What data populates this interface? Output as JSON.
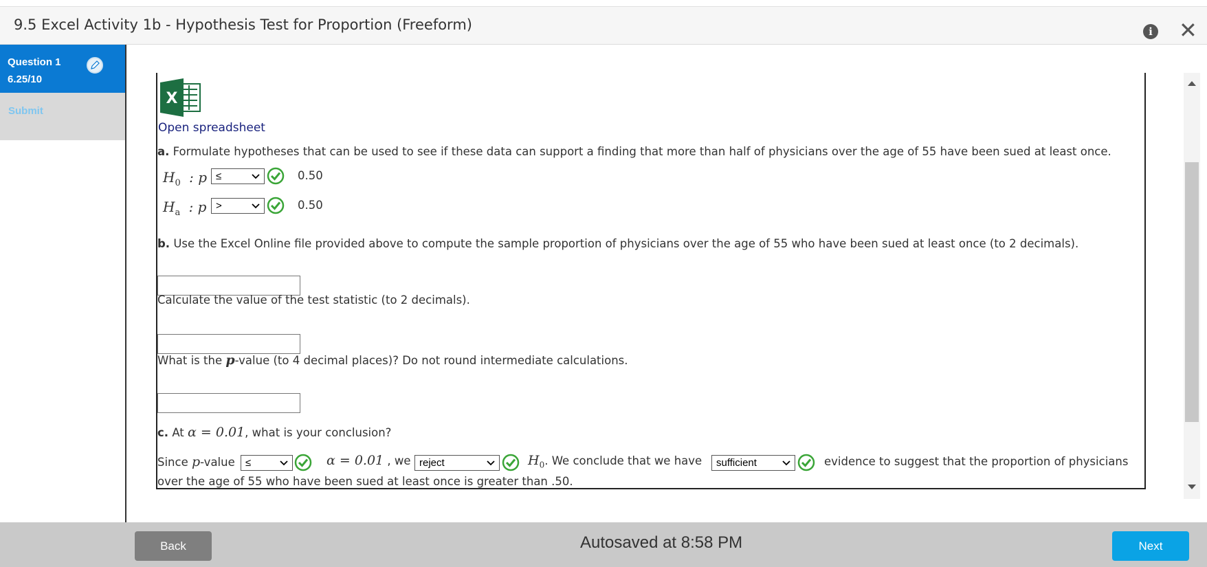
{
  "window": {
    "title": "9.5 Excel Activity 1b - Hypothesis Test for Proportion (Freeform)"
  },
  "sidebar": {
    "question_label": "Question 1",
    "question_score": "6.25/10",
    "submit_label": "Submit"
  },
  "content": {
    "open_spreadsheet": "Open spreadsheet",
    "part_a": {
      "letter": "a.",
      "text": "Formulate hypotheses that can be used to see if these data can support a finding that more than half of physicians over the age of 55 have been sued at least once.",
      "h0_symbol": "H",
      "h0_sub": "0",
      "ha_symbol": "H",
      "ha_sub": "a",
      "colon_p": ": p",
      "h0_operator": "≤",
      "h0_value": "0.50",
      "ha_operator": ">",
      "ha_value": "0.50"
    },
    "part_b": {
      "letter": "b.",
      "text": "Use the Excel Online file provided above to compute the sample proportion of physicians over the age of 55 who have been sued at least once (to 2 decimals).",
      "sample_prop_value": "",
      "test_stat_text": "Calculate the value of the test statistic (to 2 decimals).",
      "test_stat_value": "",
      "pvalue_pre": "What is the ",
      "pvalue_var": "p",
      "pvalue_post": "-value (to 4 decimal places)? Do not round intermediate calculations.",
      "pvalue_value": ""
    },
    "part_c": {
      "letter": "c.",
      "at": "At",
      "alpha_expr": "α = 0.01",
      "question": ", what is your conclusion?",
      "since": "Since",
      "p_var": "p",
      "value_word": "-value",
      "pvalue_operator": "≤",
      "alpha_expr2": "α = 0.01",
      "we": ", we",
      "decision": "reject",
      "h0_symbol": "H",
      "h0_sub": "0",
      "conclude": ". We conclude that we have",
      "evidence": "sufficient",
      "rest_1": "evidence to suggest that the proportion of physicians",
      "rest_2": "over the age of 55 who have been sued at least once is greater than .50."
    }
  },
  "footer": {
    "back_label": "Back",
    "autosaved": "Autosaved at 8:58 PM",
    "next_label": "Next"
  },
  "colors": {
    "accent": "#0b7ad3",
    "next": "#0aa3e5",
    "check": "#3aa537",
    "excel": "#1d6f42"
  }
}
